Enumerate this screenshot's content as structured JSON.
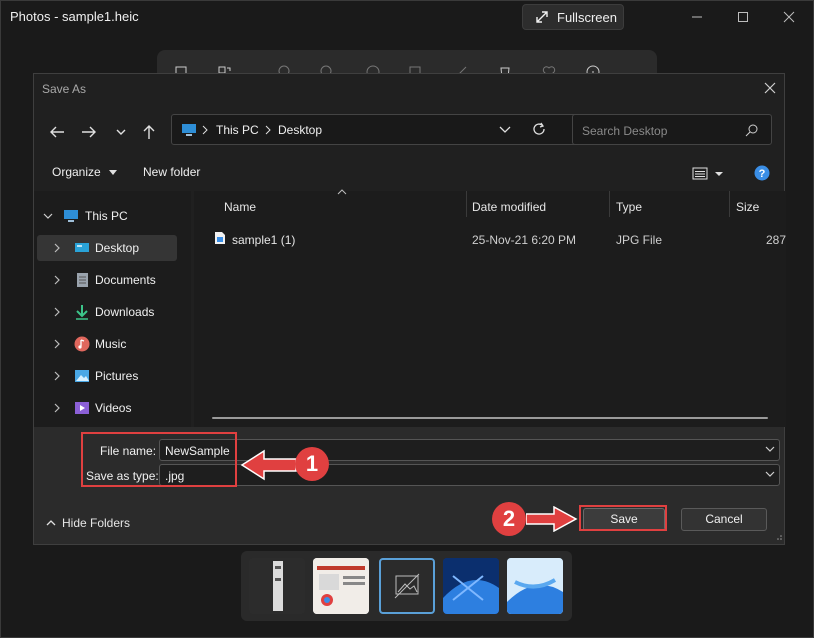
{
  "app": {
    "title": "Photos - sample1.heic",
    "fullscreen_label": "Fullscreen"
  },
  "dialog": {
    "title": "Save As",
    "address": {
      "root": "This PC",
      "current": "Desktop"
    },
    "search_placeholder": "Search Desktop",
    "toolbar": {
      "organize": "Organize",
      "new_folder": "New folder"
    },
    "nav": [
      {
        "label": "This PC",
        "icon": "monitor-icon"
      },
      {
        "label": "Desktop",
        "icon": "desktop-icon"
      },
      {
        "label": "Documents",
        "icon": "documents-icon"
      },
      {
        "label": "Downloads",
        "icon": "downloads-icon"
      },
      {
        "label": "Music",
        "icon": "music-icon"
      },
      {
        "label": "Pictures",
        "icon": "pictures-icon"
      },
      {
        "label": "Videos",
        "icon": "videos-icon"
      }
    ],
    "columns": [
      "Name",
      "Date modified",
      "Type",
      "Size"
    ],
    "files": [
      {
        "name": "sample1 (1)",
        "date": "25-Nov-21 6:20 PM",
        "type": "JPG File",
        "size": "287"
      }
    ],
    "file_name_label": "File name:",
    "file_name_value": "NewSample",
    "save_type_label": "Save as type:",
    "save_type_value": ".jpg",
    "hide_folders": "Hide Folders",
    "save_label": "Save",
    "cancel_label": "Cancel"
  },
  "annotations": {
    "step1": "1",
    "step2": "2"
  },
  "colors": {
    "annotation_red": "#e04040",
    "help_blue": "#3a8ee6"
  }
}
